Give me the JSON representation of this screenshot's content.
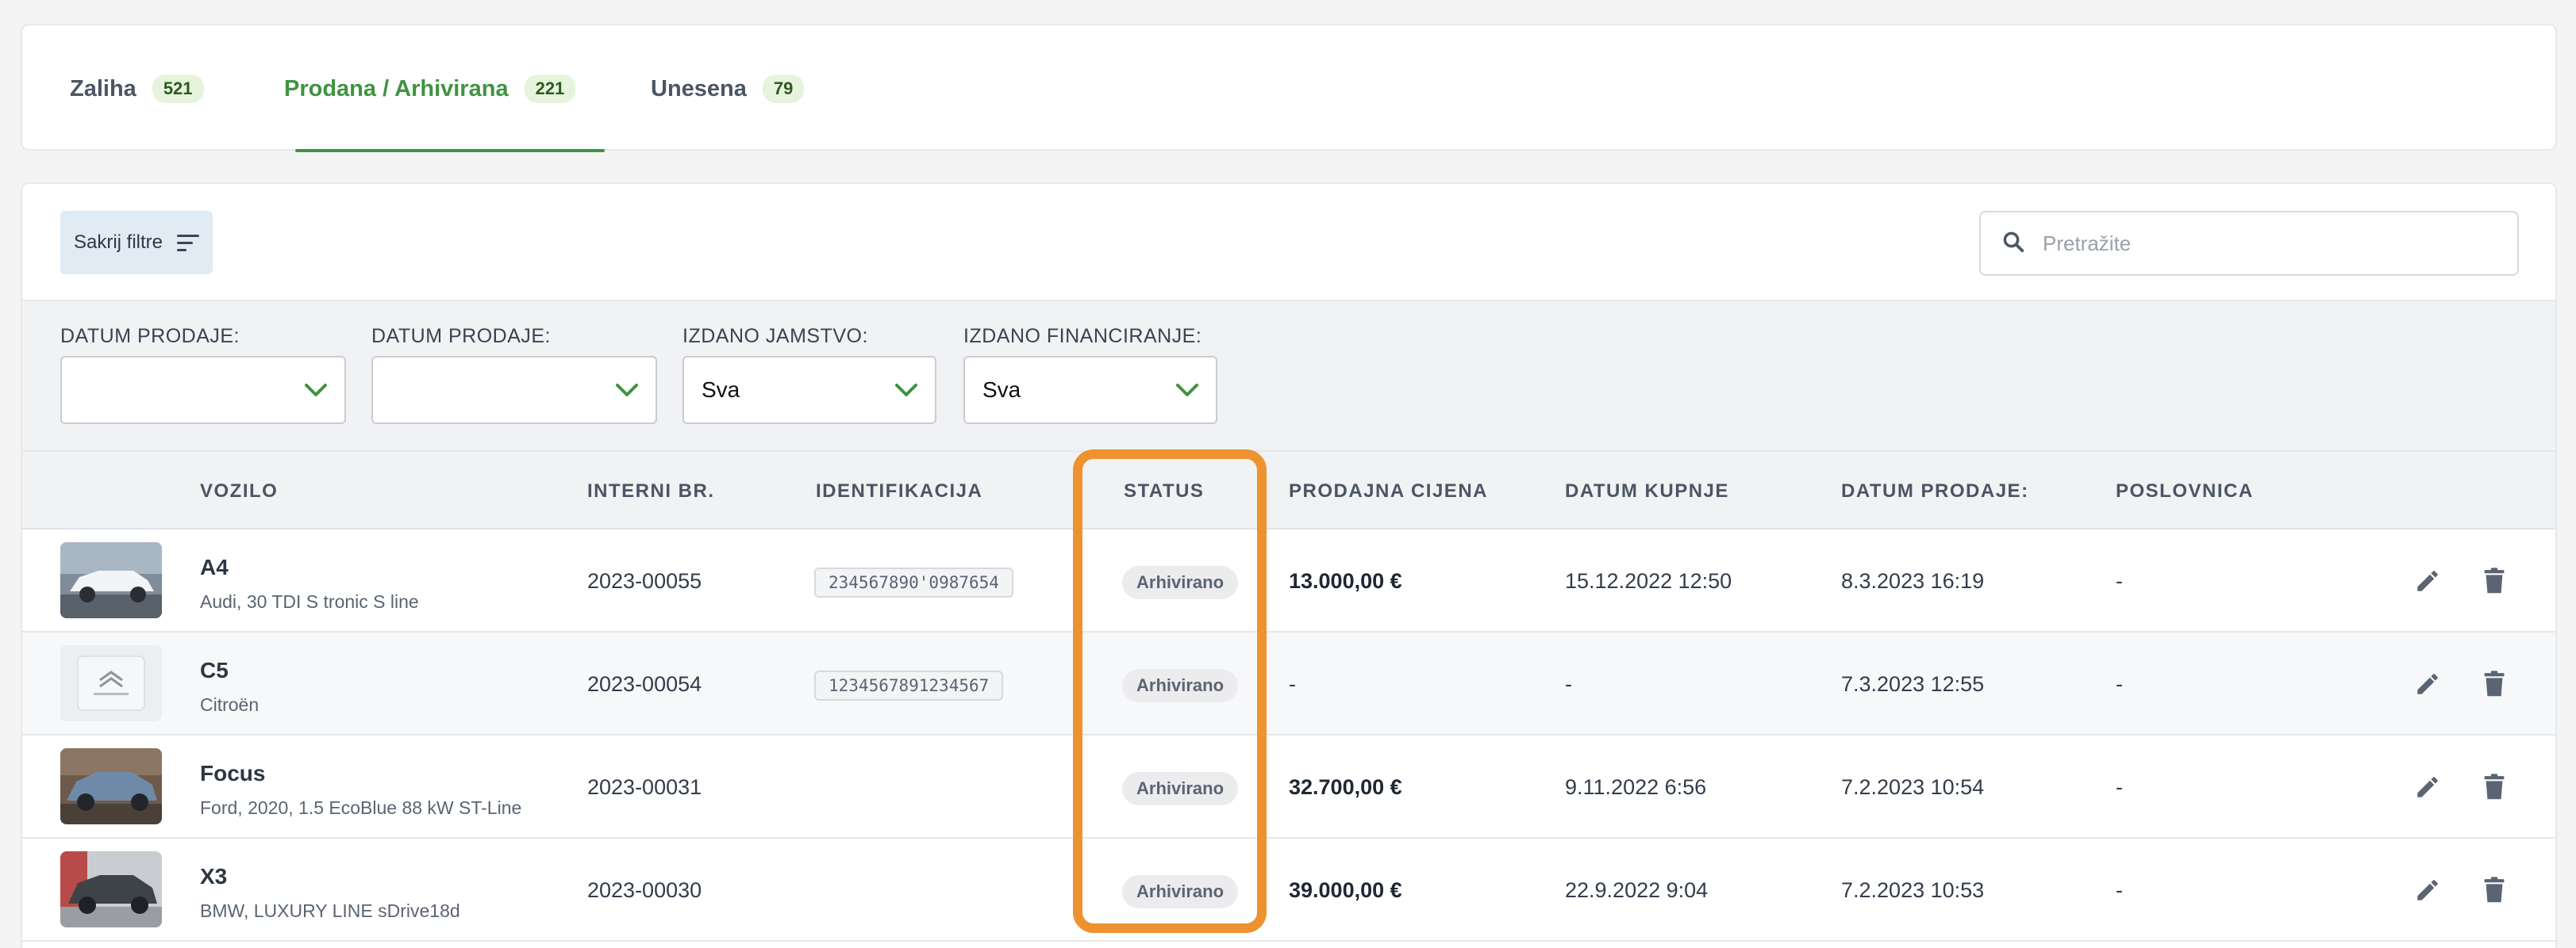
{
  "tabs": [
    {
      "label": "Zaliha",
      "count": "521"
    },
    {
      "label": "Prodana / Arhivirana",
      "count": "221"
    },
    {
      "label": "Unesena",
      "count": "79"
    }
  ],
  "toolbar": {
    "filter_button": "Sakrij filtre"
  },
  "search": {
    "placeholder": "Pretražite"
  },
  "filters": [
    {
      "label": "DATUM PRODAJE:",
      "value": ""
    },
    {
      "label": "DATUM PRODAJE:",
      "value": ""
    },
    {
      "label": "IZDANO JAMSTVO:",
      "value": "Sva"
    },
    {
      "label": "IZDANO FINANCIRANJE:",
      "value": "Sva"
    }
  ],
  "table": {
    "columns": [
      "VOZILO",
      "INTERNI BR.",
      "IDENTIFIKACIJA",
      "STATUS",
      "PRODAJNA CIJENA",
      "DATUM KUPNJE",
      "DATUM PRODAJE:",
      "POSLOVNICA"
    ],
    "rows": [
      {
        "model": "A4",
        "variant": "Audi, 30 TDI S tronic S line",
        "internal": "2023-00055",
        "ident": "234567890'0987654",
        "status": "Arhivirano",
        "price": "13.000,00 €",
        "bought": "15.12.2022 12:50",
        "sold": "8.3.2023 16:19",
        "branch": "-"
      },
      {
        "model": "C5",
        "variant": "Citroën",
        "internal": "2023-00054",
        "ident": "1234567891234567",
        "status": "Arhivirano",
        "price": "-",
        "bought": "-",
        "sold": "7.3.2023 12:55",
        "branch": "-"
      },
      {
        "model": "Focus",
        "variant": "Ford, 2020, 1.5 EcoBlue 88 kW ST-Line",
        "internal": "2023-00031",
        "ident": "",
        "status": "Arhivirano",
        "price": "32.700,00 €",
        "bought": "9.11.2022 6:56",
        "sold": "7.2.2023 10:54",
        "branch": "-"
      },
      {
        "model": "X3",
        "variant": "BMW, LUXURY LINE sDrive18d",
        "internal": "2023-00030",
        "ident": "",
        "status": "Arhivirano",
        "price": "39.000,00 €",
        "bought": "22.9.2022 9:04",
        "sold": "7.2.2023 10:53",
        "branch": "-"
      }
    ]
  },
  "colors": {
    "accent": "#3f9341",
    "highlight": "#ee9230",
    "count_badge": "#e6f4dd"
  },
  "icons": [
    "filter-icon",
    "search-icon",
    "chevron-down-icon",
    "edit-icon",
    "delete-icon"
  ]
}
